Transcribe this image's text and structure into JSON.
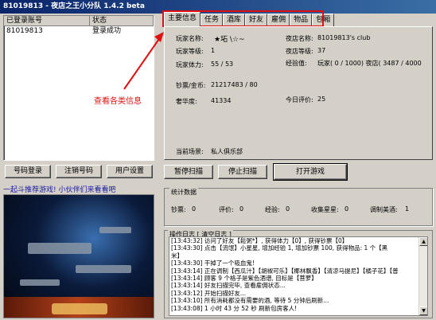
{
  "title": "81019813 - 夜店之王小分队 1.4.2 beta",
  "accounts": {
    "headers": [
      "已登录账号",
      "状态"
    ],
    "rows": [
      {
        "account": "81019813",
        "status": "登录成功"
      }
    ]
  },
  "buttons": {
    "login": "号码登录",
    "logout": "注销号码",
    "settings": "用户设置",
    "pause": "暂停扫描",
    "stop": "停止扫描",
    "open_game": "打开游戏"
  },
  "ad": {
    "text": "一起斗推荐游戏! 小伙伴们来看看吧"
  },
  "tabs": [
    "主要信息",
    "任务",
    "酒库",
    "好友",
    "雇佣",
    "物品",
    "包厢"
  ],
  "info": {
    "player_name_label": "玩家名称:",
    "player_name": "★坧 \\☆~",
    "club_name_label": "夜店名称:",
    "club_name": "81019813's club",
    "player_level_label": "玩家等级:",
    "player_level": "1",
    "club_level_label": "夜店等级:",
    "club_level": "37",
    "stamina_label": "玩家体力:",
    "stamina": "55 / 53",
    "exp_label": "经验值:",
    "exp": "玩家( 0 / 1000)  夜店( 3487 / 4000",
    "money_label": "钞票/金币:",
    "money": "21217483 / 80",
    "luxury_label": "奢华度:",
    "luxury": "41334",
    "rating_label": "今日评价:",
    "rating": "25",
    "scene_label": "当前场景:",
    "scene": "私人俱乐部"
  },
  "annotation": "查看各类信息",
  "stats": {
    "title": "统计数据",
    "items": [
      {
        "label": "钞票:",
        "value": "0"
      },
      {
        "label": "评价:",
        "value": "0"
      },
      {
        "label": "经验:",
        "value": "0"
      },
      {
        "label": "收集星星:",
        "value": "0"
      },
      {
        "label": "调制美酒:",
        "value": "1"
      }
    ]
  },
  "log": {
    "title": "操作日志",
    "clear": "[ 清空日志 ]",
    "lines": [
      "[13:43:32] 访问了好友【鬆粥*】, 获得体力【0】, 获得钞票【0】",
      "[13:43:30] 点击【流氓】小星星, 增加经验 1, 增加钞票 100, 获得物品: 1 个【黑",
      "米】",
      "[13:43:30] 干掉了一个吸血鬼!",
      "[13:43:14] 正在调制【西瓜汁】【胡椒可乐】【椰林飘香】【清凉马提尼】【橘子花】【普",
      "[13:43:14] 顾客 9 个格子是紫色酒谱, 目标是【菩萝】",
      "[13:43:14] 好友扫描完毕, 查看雇佣状态...",
      "[13:43:12] 开始扫描好友...",
      "[13:43:10] 所有消耗都没有需要的酒, 等待 5 分钟后刷新...",
      "[13:43:08] 1 小时 43 分 52 秒 刷新包房客人!"
    ]
  }
}
